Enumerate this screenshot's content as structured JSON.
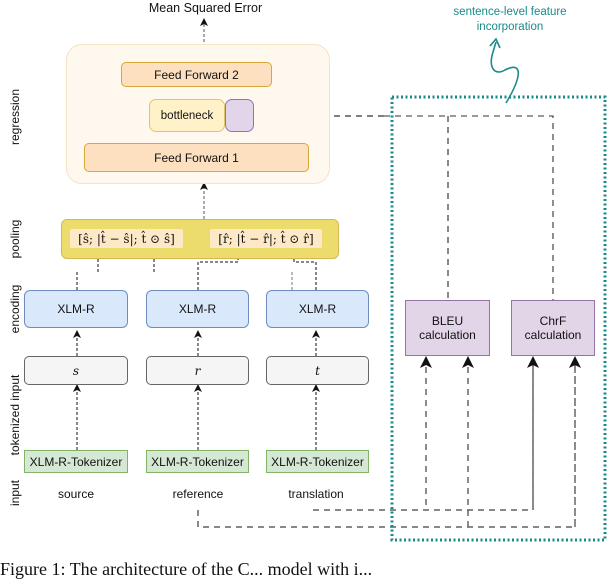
{
  "diagram": {
    "output_label": "Mean Squared Error",
    "stage_labels": {
      "regression": "regression",
      "pooling": "pooling",
      "encoding": "encoding",
      "tokenized_input": "tokenized input",
      "input": "input"
    },
    "regression": {
      "feed_forward_2": "Feed Forward 2",
      "bottleneck": "bottleneck",
      "feed_forward_1": "Feed Forward 1"
    },
    "pooling": {
      "source_expr": "[ŝ; |t̂ − ŝ|; t̂ ⊙ ŝ]",
      "reference_expr": "[r̂; |t̂ − r̂|; t̂ ⊙ r̂]"
    },
    "encoders": [
      "XLM-R",
      "XLM-R",
      "XLM-R"
    ],
    "tokens": [
      "s",
      "r",
      "t"
    ],
    "tokenizers": [
      "XLM-R-Tokenizer",
      "XLM-R-Tokenizer",
      "XLM-R-Tokenizer"
    ],
    "inputs": [
      "source",
      "reference",
      "translation"
    ],
    "sentence_features": {
      "annotation_line1": "sentence-level feature",
      "annotation_line2": "incorporation",
      "bleu_line1": "BLEU",
      "bleu_line2": "calculation",
      "chrf_line1": "ChrF",
      "chrf_line2": "calculation"
    },
    "colors": {
      "accent_teal": "#1a8a8a",
      "feed_forward": "#fde0c0",
      "bottleneck": "#fff2c8",
      "feature_slot": "#e2d5ea",
      "pooling": "#ecdc6c",
      "encoder": "#dae8fc",
      "tokenizer": "#d5e8d4",
      "calculation": "#e1d5e7"
    }
  },
  "caption": "Figure 1: The architecture of the C... model with i..."
}
